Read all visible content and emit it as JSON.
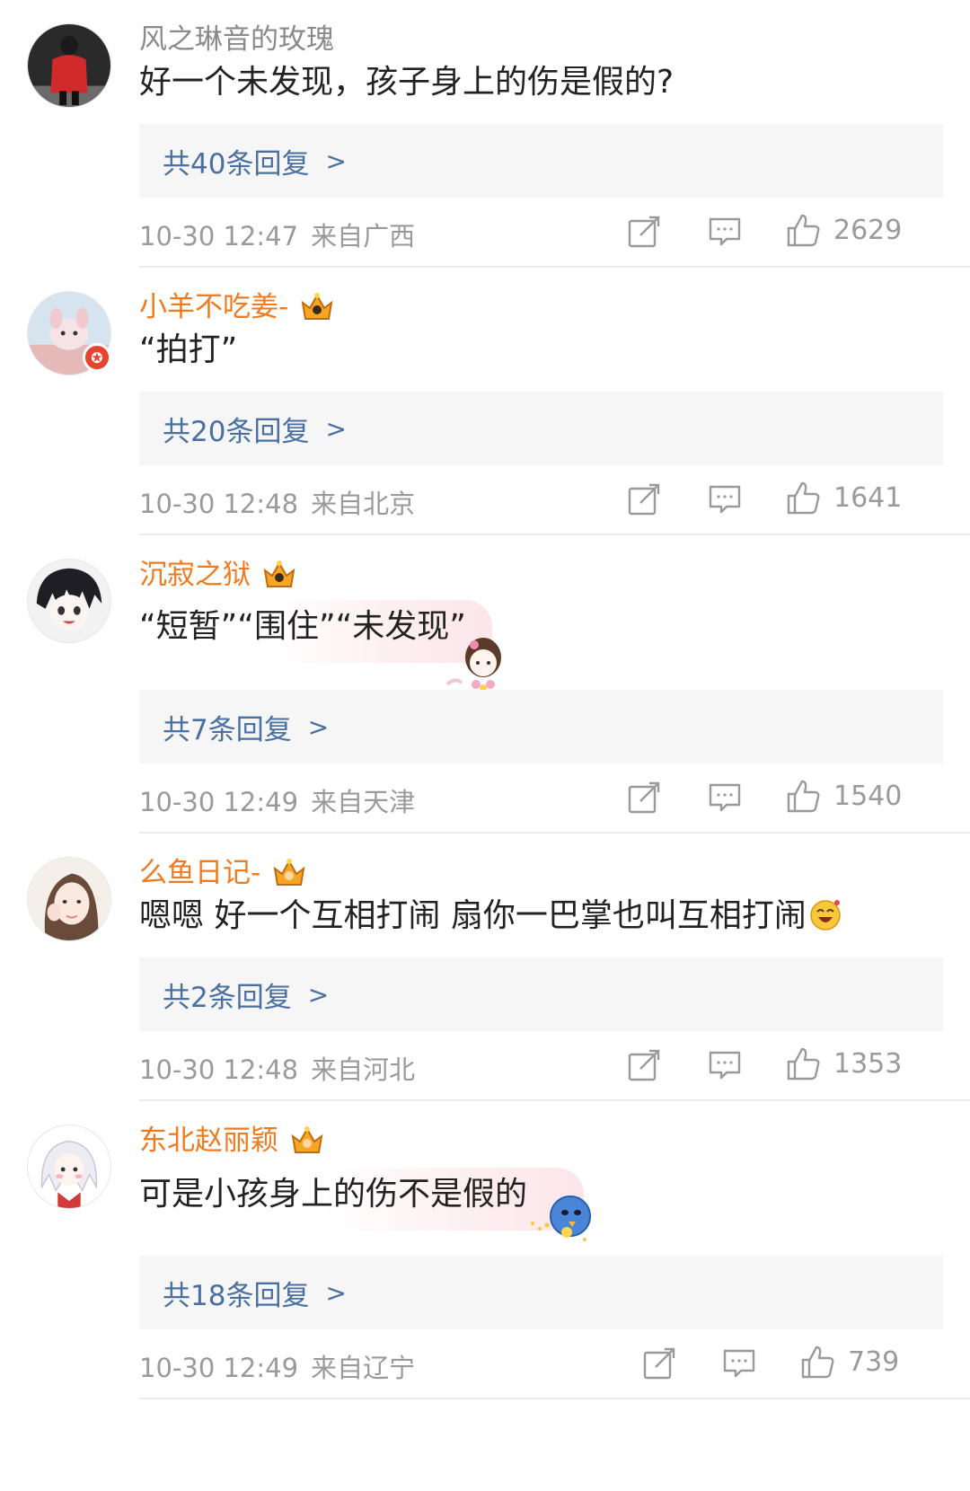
{
  "colors": {
    "username_orange": "#f07a20",
    "username_plain": "#8a8a8a",
    "reply_link": "#4a6fa1",
    "reply_bg": "#f6f6f6",
    "meta_gray": "#9a9a9a"
  },
  "icons": {
    "share": "share-square-icon",
    "comment": "comment-bubble-icon",
    "like": "thumbs-up-icon",
    "chevron": "chevron-right-icon",
    "crown": "crown-badge-icon"
  },
  "comments": [
    {
      "username": "风之琳音的玫瑰",
      "text": "好一个未发现，孩子身上的伤是假的?",
      "replies": "共40条回复",
      "time": "10-30 12:47",
      "location": "来自广西",
      "likes": "2629"
    },
    {
      "username": "小羊不吃姜-",
      "text": "“拍打”",
      "replies": "共20条回复",
      "time": "10-30 12:48",
      "location": "来自北京",
      "likes": "1641"
    },
    {
      "username": "沉寂之狱",
      "text": "“短暂”“围住”“未发现”",
      "replies": "共7条回复",
      "time": "10-30 12:49",
      "location": "来自天津",
      "likes": "1540"
    },
    {
      "username": "么鱼日记-",
      "text": "嗯嗯 好一个互相打闹 扇你一巴掌也叫互相打闹",
      "replies": "共2条回复",
      "time": "10-30 12:48",
      "location": "来自河北",
      "likes": "1353"
    },
    {
      "username": "东北赵丽颖",
      "text": "可是小孩身上的伤不是假的",
      "replies": "共18条回复",
      "time": "10-30 12:49",
      "location": "来自辽宁",
      "likes": "739"
    }
  ]
}
